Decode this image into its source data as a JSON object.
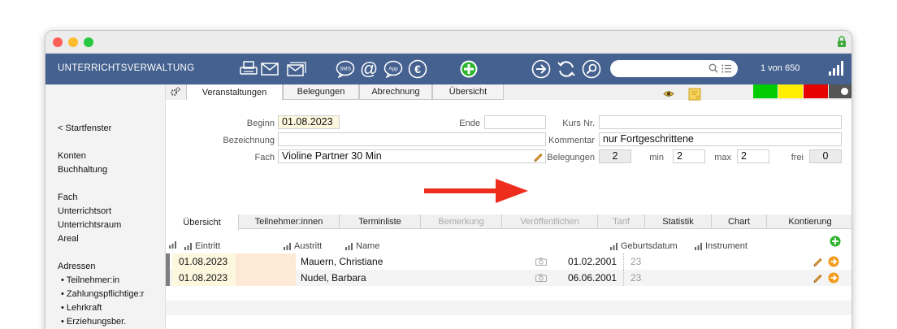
{
  "app": {
    "title": "UNTERRICHTSVERWALTUNG",
    "record_count": "1 von 650",
    "search_placeholder": ""
  },
  "toolbar_icons": [
    "print-icon",
    "email-icon",
    "email-multi-icon",
    "sms-icon",
    "at-icon",
    "app-icon",
    "euro-icon",
    "add-icon",
    "next-icon",
    "refresh-icon",
    "search-icon"
  ],
  "sidebar": {
    "back": "< Startfenster",
    "items": [
      {
        "label": "Konten"
      },
      {
        "label": "Buchhaltung"
      },
      {
        "label": "Fach"
      },
      {
        "label": "Unterrichtsort"
      },
      {
        "label": "Unterrichtsraum"
      },
      {
        "label": "Areal"
      },
      {
        "label": "Adressen"
      },
      {
        "label": "• Teilnehmer:in"
      },
      {
        "label": "• Zahlungspflichtige:r"
      },
      {
        "label": "• Lehrkraft"
      },
      {
        "label": "• Erziehungsber."
      }
    ]
  },
  "top_tabs": [
    {
      "label": "Veranstaltungen"
    },
    {
      "label": "Belegungen"
    },
    {
      "label": "Abrechnung"
    },
    {
      "label": "Übersicht"
    }
  ],
  "status_colors": [
    "#00cc00",
    "#ffee00",
    "#e60000"
  ],
  "form": {
    "beginn_label": "Beginn",
    "beginn_value": "01.08.2023",
    "ende_label": "Ende",
    "ende_value": "",
    "bezeichnung_label": "Bezeichnung",
    "bezeichnung_value": "",
    "fach_label": "Fach",
    "fach_value": "Violine Partner 30 Min",
    "kurs_label": "Kurs Nr.",
    "kurs_value": "",
    "kommentar_label": "Kommentar",
    "kommentar_value": "nur Fortgeschrittene",
    "belegungen_label": "Belegungen",
    "belegungen_value": "2",
    "min_label": "min",
    "min_value": "2",
    "max_label": "max",
    "max_value": "2",
    "frei_label": "frei",
    "frei_value": "0"
  },
  "sub_tabs": [
    {
      "label": "Übersicht",
      "state": "active"
    },
    {
      "label": "Teilnehmer:innen",
      "state": "normal"
    },
    {
      "label": "Terminliste",
      "state": "normal"
    },
    {
      "label": "Bemerkung",
      "state": "disabled"
    },
    {
      "label": "Veröffentlichen",
      "state": "disabled"
    },
    {
      "label": "Tarif",
      "state": "disabled"
    },
    {
      "label": "Statistik",
      "state": "normal"
    },
    {
      "label": "Chart",
      "state": "normal"
    },
    {
      "label": "Kontierung",
      "state": "normal"
    }
  ],
  "table": {
    "headers": {
      "eintritt": "Eintritt",
      "austritt": "Austritt",
      "name": "Name",
      "geburtsdatum": "Geburtsdatum",
      "instrument": "Instrument"
    },
    "rows": [
      {
        "eintritt": "01.08.2023",
        "austritt": "",
        "name": "Mauern, Christiane",
        "geburtsdatum": "01.02.2001",
        "alter": "23",
        "instrument": ""
      },
      {
        "eintritt": "01.08.2023",
        "austritt": "",
        "name": "Nudel, Barbara",
        "geburtsdatum": "06.06.2001",
        "alter": "23",
        "instrument": ""
      }
    ]
  }
}
